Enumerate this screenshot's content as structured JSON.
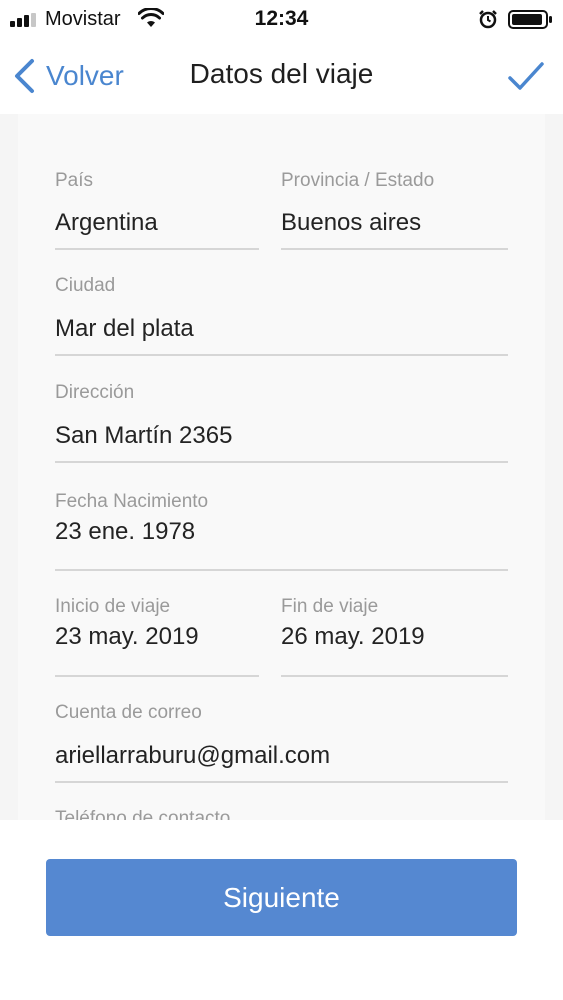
{
  "status_bar": {
    "carrier": "Movistar",
    "time": "12:34",
    "icons": [
      "signal-icon",
      "wifi-icon",
      "alarm-icon",
      "battery-icon"
    ]
  },
  "nav": {
    "back_label": "Volver",
    "title": "Datos del viaje",
    "back_icon": "chevron-left-icon",
    "confirm_icon": "checkmark-icon"
  },
  "form": {
    "country": {
      "label": "País",
      "value": "Argentina"
    },
    "province": {
      "label": "Provincia / Estado",
      "value": "Buenos aires"
    },
    "city": {
      "label": "Ciudad",
      "value": "Mar del plata"
    },
    "address": {
      "label": "Dirección",
      "value": "San Martín 2365"
    },
    "birth_date": {
      "label": "Fecha Nacimiento",
      "value": "23 ene. 1978"
    },
    "trip_start": {
      "label": "Inicio de viaje",
      "value": "23 may. 2019"
    },
    "trip_end": {
      "label": "Fin de viaje",
      "value": "26 may. 2019"
    },
    "email": {
      "label": "Cuenta de correo",
      "value": "ariellarraburu@gmail.com"
    },
    "phone": {
      "label": "Teléfono de contacto"
    }
  },
  "actions": {
    "next_label": "Siguiente"
  },
  "colors": {
    "accent": "#4a86cf",
    "button": "#5588d1",
    "label": "#9a9a9a",
    "divider": "#d6d6d6"
  }
}
